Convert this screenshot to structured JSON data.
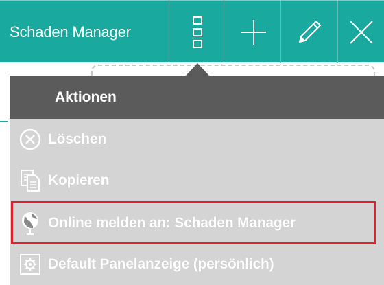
{
  "toolbar": {
    "title": "Schaden Manager",
    "buttons": [
      {
        "icon": "grid-menu-icon"
      },
      {
        "icon": "plus-icon"
      },
      {
        "icon": "pencil-icon"
      },
      {
        "icon": "close-icon"
      }
    ],
    "background": "#1aa99f"
  },
  "menu": {
    "header": "Aktionen",
    "items": [
      {
        "label": "Löschen",
        "icon": "delete-circle-icon"
      },
      {
        "label": "Kopieren",
        "icon": "copy-icon"
      },
      {
        "label": "Online melden an: Schaden Manager",
        "icon": "globe-pin-icon",
        "highlighted": true
      },
      {
        "label": "Default Panelanzeige (persönlich)",
        "icon": "settings-gear-icon"
      }
    ],
    "highlight_color": "#e0202a"
  }
}
